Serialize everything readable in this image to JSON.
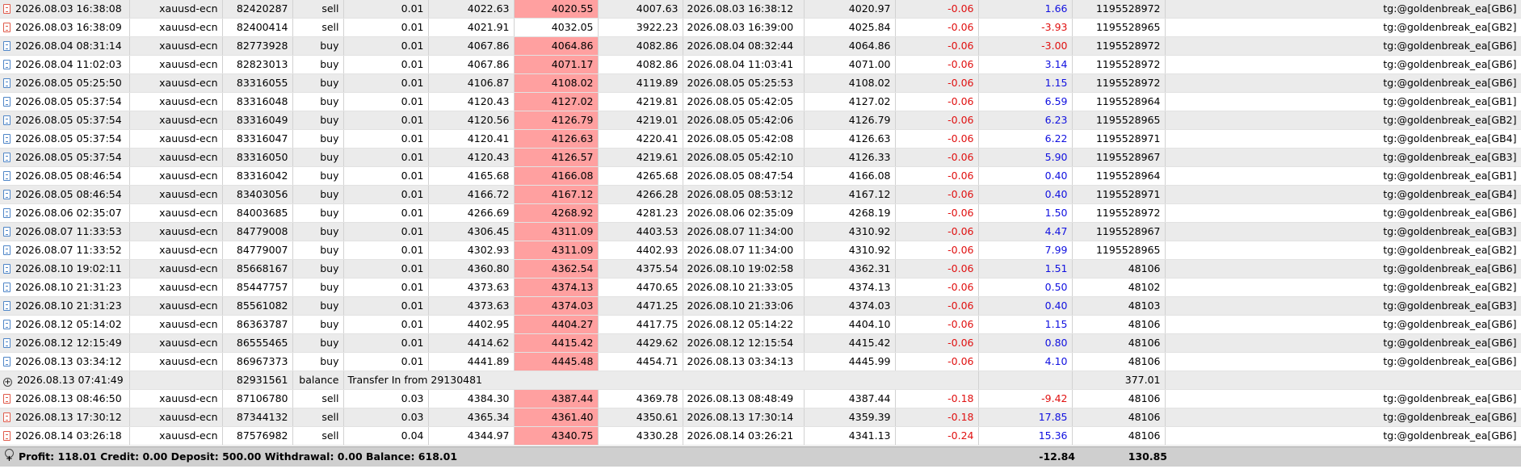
{
  "rows": [
    {
      "kind": "trade",
      "time": "2026.08.03 16:38:08",
      "symbol": "xauusd-ecn",
      "ticket": "82420287",
      "type": "sell",
      "volume": "0.01",
      "price": "4022.63",
      "sl": "4020.55",
      "tp": "4007.63",
      "close_time": "2026.08.03 16:38:12",
      "close_price": "4020.97",
      "swap": "-0.06",
      "profit": "1.66",
      "magic": "1195528972",
      "comment": "tg:@goldenbreak_ea[GB6]",
      "sl_hl": true,
      "profit_neg": false
    },
    {
      "kind": "trade",
      "time": "2026.08.03 16:38:09",
      "symbol": "xauusd-ecn",
      "ticket": "82400414",
      "type": "sell",
      "volume": "0.01",
      "price": "4021.91",
      "sl": "4032.05",
      "tp": "3922.23",
      "close_time": "2026.08.03 16:39:00",
      "close_price": "4025.84",
      "swap": "-0.06",
      "profit": "-3.93",
      "magic": "1195528965",
      "comment": "tg:@goldenbreak_ea[GB2]",
      "sl_hl": false,
      "profit_neg": true
    },
    {
      "kind": "trade",
      "time": "2026.08.04 08:31:14",
      "symbol": "xauusd-ecn",
      "ticket": "82773928",
      "type": "buy",
      "volume": "0.01",
      "price": "4067.86",
      "sl": "4064.86",
      "tp": "4082.86",
      "close_time": "2026.08.04 08:32:44",
      "close_price": "4064.86",
      "swap": "-0.06",
      "profit": "-3.00",
      "magic": "1195528972",
      "comment": "tg:@goldenbreak_ea[GB6]",
      "sl_hl": true,
      "profit_neg": true
    },
    {
      "kind": "trade",
      "time": "2026.08.04 11:02:03",
      "symbol": "xauusd-ecn",
      "ticket": "82823013",
      "type": "buy",
      "volume": "0.01",
      "price": "4067.86",
      "sl": "4071.17",
      "tp": "4082.86",
      "close_time": "2026.08.04 11:03:41",
      "close_price": "4071.00",
      "swap": "-0.06",
      "profit": "3.14",
      "magic": "1195528972",
      "comment": "tg:@goldenbreak_ea[GB6]",
      "sl_hl": true,
      "profit_neg": false
    },
    {
      "kind": "trade",
      "time": "2026.08.05 05:25:50",
      "symbol": "xauusd-ecn",
      "ticket": "83316055",
      "type": "buy",
      "volume": "0.01",
      "price": "4106.87",
      "sl": "4108.02",
      "tp": "4119.89",
      "close_time": "2026.08.05 05:25:53",
      "close_price": "4108.02",
      "swap": "-0.06",
      "profit": "1.15",
      "magic": "1195528972",
      "comment": "tg:@goldenbreak_ea[GB6]",
      "sl_hl": true,
      "profit_neg": false
    },
    {
      "kind": "trade",
      "time": "2026.08.05 05:37:54",
      "symbol": "xauusd-ecn",
      "ticket": "83316048",
      "type": "buy",
      "volume": "0.01",
      "price": "4120.43",
      "sl": "4127.02",
      "tp": "4219.81",
      "close_time": "2026.08.05 05:42:05",
      "close_price": "4127.02",
      "swap": "-0.06",
      "profit": "6.59",
      "magic": "1195528964",
      "comment": "tg:@goldenbreak_ea[GB1]",
      "sl_hl": true,
      "profit_neg": false
    },
    {
      "kind": "trade",
      "time": "2026.08.05 05:37:54",
      "symbol": "xauusd-ecn",
      "ticket": "83316049",
      "type": "buy",
      "volume": "0.01",
      "price": "4120.56",
      "sl": "4126.79",
      "tp": "4219.01",
      "close_time": "2026.08.05 05:42:06",
      "close_price": "4126.79",
      "swap": "-0.06",
      "profit": "6.23",
      "magic": "1195528965",
      "comment": "tg:@goldenbreak_ea[GB2]",
      "sl_hl": true,
      "profit_neg": false
    },
    {
      "kind": "trade",
      "time": "2026.08.05 05:37:54",
      "symbol": "xauusd-ecn",
      "ticket": "83316047",
      "type": "buy",
      "volume": "0.01",
      "price": "4120.41",
      "sl": "4126.63",
      "tp": "4220.41",
      "close_time": "2026.08.05 05:42:08",
      "close_price": "4126.63",
      "swap": "-0.06",
      "profit": "6.22",
      "magic": "1195528971",
      "comment": "tg:@goldenbreak_ea[GB4]",
      "sl_hl": true,
      "profit_neg": false
    },
    {
      "kind": "trade",
      "time": "2026.08.05 05:37:54",
      "symbol": "xauusd-ecn",
      "ticket": "83316050",
      "type": "buy",
      "volume": "0.01",
      "price": "4120.43",
      "sl": "4126.57",
      "tp": "4219.61",
      "close_time": "2026.08.05 05:42:10",
      "close_price": "4126.33",
      "swap": "-0.06",
      "profit": "5.90",
      "magic": "1195528967",
      "comment": "tg:@goldenbreak_ea[GB3]",
      "sl_hl": true,
      "profit_neg": false
    },
    {
      "kind": "trade",
      "time": "2026.08.05 08:46:54",
      "symbol": "xauusd-ecn",
      "ticket": "83316042",
      "type": "buy",
      "volume": "0.01",
      "price": "4165.68",
      "sl": "4166.08",
      "tp": "4265.68",
      "close_time": "2026.08.05 08:47:54",
      "close_price": "4166.08",
      "swap": "-0.06",
      "profit": "0.40",
      "magic": "1195528964",
      "comment": "tg:@goldenbreak_ea[GB1]",
      "sl_hl": true,
      "profit_neg": false
    },
    {
      "kind": "trade",
      "time": "2026.08.05 08:46:54",
      "symbol": "xauusd-ecn",
      "ticket": "83403056",
      "type": "buy",
      "volume": "0.01",
      "price": "4166.72",
      "sl": "4167.12",
      "tp": "4266.28",
      "close_time": "2026.08.05 08:53:12",
      "close_price": "4167.12",
      "swap": "-0.06",
      "profit": "0.40",
      "magic": "1195528971",
      "comment": "tg:@goldenbreak_ea[GB4]",
      "sl_hl": true,
      "profit_neg": false
    },
    {
      "kind": "trade",
      "time": "2026.08.06 02:35:07",
      "symbol": "xauusd-ecn",
      "ticket": "84003685",
      "type": "buy",
      "volume": "0.01",
      "price": "4266.69",
      "sl": "4268.92",
      "tp": "4281.23",
      "close_time": "2026.08.06 02:35:09",
      "close_price": "4268.19",
      "swap": "-0.06",
      "profit": "1.50",
      "magic": "1195528972",
      "comment": "tg:@goldenbreak_ea[GB6]",
      "sl_hl": true,
      "profit_neg": false
    },
    {
      "kind": "trade",
      "time": "2026.08.07 11:33:53",
      "symbol": "xauusd-ecn",
      "ticket": "84779008",
      "type": "buy",
      "volume": "0.01",
      "price": "4306.45",
      "sl": "4311.09",
      "tp": "4403.53",
      "close_time": "2026.08.07 11:34:00",
      "close_price": "4310.92",
      "swap": "-0.06",
      "profit": "4.47",
      "magic": "1195528967",
      "comment": "tg:@goldenbreak_ea[GB3]",
      "sl_hl": true,
      "profit_neg": false
    },
    {
      "kind": "trade",
      "time": "2026.08.07 11:33:52",
      "symbol": "xauusd-ecn",
      "ticket": "84779007",
      "type": "buy",
      "volume": "0.01",
      "price": "4302.93",
      "sl": "4311.09",
      "tp": "4402.93",
      "close_time": "2026.08.07 11:34:00",
      "close_price": "4310.92",
      "swap": "-0.06",
      "profit": "7.99",
      "magic": "1195528965",
      "comment": "tg:@goldenbreak_ea[GB2]",
      "sl_hl": true,
      "profit_neg": false
    },
    {
      "kind": "trade",
      "time": "2026.08.10 19:02:11",
      "symbol": "xauusd-ecn",
      "ticket": "85668167",
      "type": "buy",
      "volume": "0.01",
      "price": "4360.80",
      "sl": "4362.54",
      "tp": "4375.54",
      "close_time": "2026.08.10 19:02:58",
      "close_price": "4362.31",
      "swap": "-0.06",
      "profit": "1.51",
      "magic": "48106",
      "comment": "tg:@goldenbreak_ea[GB6]",
      "sl_hl": true,
      "profit_neg": false
    },
    {
      "kind": "trade",
      "time": "2026.08.10 21:31:23",
      "symbol": "xauusd-ecn",
      "ticket": "85447757",
      "type": "buy",
      "volume": "0.01",
      "price": "4373.63",
      "sl": "4374.13",
      "tp": "4470.65",
      "close_time": "2026.08.10 21:33:05",
      "close_price": "4374.13",
      "swap": "-0.06",
      "profit": "0.50",
      "magic": "48102",
      "comment": "tg:@goldenbreak_ea[GB2]",
      "sl_hl": true,
      "profit_neg": false
    },
    {
      "kind": "trade",
      "time": "2026.08.10 21:31:23",
      "symbol": "xauusd-ecn",
      "ticket": "85561082",
      "type": "buy",
      "volume": "0.01",
      "price": "4373.63",
      "sl": "4374.03",
      "tp": "4471.25",
      "close_time": "2026.08.10 21:33:06",
      "close_price": "4374.03",
      "swap": "-0.06",
      "profit": "0.40",
      "magic": "48103",
      "comment": "tg:@goldenbreak_ea[GB3]",
      "sl_hl": true,
      "profit_neg": false
    },
    {
      "kind": "trade",
      "time": "2026.08.12 05:14:02",
      "symbol": "xauusd-ecn",
      "ticket": "86363787",
      "type": "buy",
      "volume": "0.01",
      "price": "4402.95",
      "sl": "4404.27",
      "tp": "4417.75",
      "close_time": "2026.08.12 05:14:22",
      "close_price": "4404.10",
      "swap": "-0.06",
      "profit": "1.15",
      "magic": "48106",
      "comment": "tg:@goldenbreak_ea[GB6]",
      "sl_hl": true,
      "profit_neg": false
    },
    {
      "kind": "trade",
      "time": "2026.08.12 12:15:49",
      "symbol": "xauusd-ecn",
      "ticket": "86555465",
      "type": "buy",
      "volume": "0.01",
      "price": "4414.62",
      "sl": "4415.42",
      "tp": "4429.62",
      "close_time": "2026.08.12 12:15:54",
      "close_price": "4415.42",
      "swap": "-0.06",
      "profit": "0.80",
      "magic": "48106",
      "comment": "tg:@goldenbreak_ea[GB6]",
      "sl_hl": true,
      "profit_neg": false
    },
    {
      "kind": "trade",
      "time": "2026.08.13 03:34:12",
      "symbol": "xauusd-ecn",
      "ticket": "86967373",
      "type": "buy",
      "volume": "0.01",
      "price": "4441.89",
      "sl": "4445.48",
      "tp": "4454.71",
      "close_time": "2026.08.13 03:34:13",
      "close_price": "4445.99",
      "swap": "-0.06",
      "profit": "4.10",
      "magic": "48106",
      "comment": "tg:@goldenbreak_ea[GB6]",
      "sl_hl": true,
      "profit_neg": false
    },
    {
      "kind": "balance",
      "time": "2026.08.13 07:41:49",
      "ticket": "82931561",
      "type": "balance",
      "note": "Transfer In from 29130481",
      "profit": "377.01",
      "comment": "Transfer In from 29130481"
    },
    {
      "kind": "trade",
      "time": "2026.08.13 08:46:50",
      "symbol": "xauusd-ecn",
      "ticket": "87106780",
      "type": "sell",
      "volume": "0.03",
      "price": "4384.30",
      "sl": "4387.44",
      "tp": "4369.78",
      "close_time": "2026.08.13 08:48:49",
      "close_price": "4387.44",
      "swap": "-0.18",
      "profit": "-9.42",
      "magic": "48106",
      "comment": "tg:@goldenbreak_ea[GB6]",
      "sl_hl": true,
      "profit_neg": true
    },
    {
      "kind": "trade",
      "time": "2026.08.13 17:30:12",
      "symbol": "xauusd-ecn",
      "ticket": "87344132",
      "type": "sell",
      "volume": "0.03",
      "price": "4365.34",
      "sl": "4361.40",
      "tp": "4350.61",
      "close_time": "2026.08.13 17:30:14",
      "close_price": "4359.39",
      "swap": "-0.18",
      "profit": "17.85",
      "magic": "48106",
      "comment": "tg:@goldenbreak_ea[GB6]",
      "sl_hl": true,
      "profit_neg": false
    },
    {
      "kind": "trade",
      "time": "2026.08.14 03:26:18",
      "symbol": "xauusd-ecn",
      "ticket": "87576982",
      "type": "sell",
      "volume": "0.04",
      "price": "4344.97",
      "sl": "4340.75",
      "tp": "4330.28",
      "close_time": "2026.08.14 03:26:21",
      "close_price": "4341.13",
      "swap": "-0.24",
      "profit": "15.36",
      "magic": "48106",
      "comment": "tg:@goldenbreak_ea[GB6]",
      "sl_hl": true,
      "profit_neg": false
    }
  ],
  "summary": {
    "text": "Profit: 118.01  Credit: 0.00  Deposit: 500.00  Withdrawal: 0.00  Balance: 618.01",
    "swap_total": "-12.84",
    "profit_total": "130.85"
  },
  "colors": {
    "negative": "#e01010",
    "positive": "#1010e0",
    "highlight": "#ffa0a0"
  }
}
